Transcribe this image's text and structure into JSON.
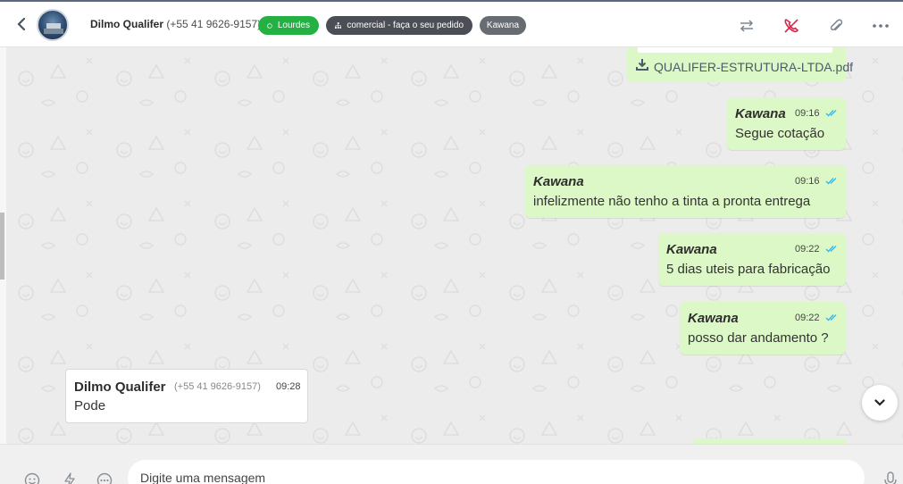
{
  "header": {
    "contact_name": "Dilmo Qualifer",
    "contact_phone": "(+55 41 9626-9157)",
    "tags": [
      {
        "label": "Lourdes",
        "color": "#25b043",
        "icon": "whatsapp-icon"
      },
      {
        "label": "comercial - faça o seu pedido",
        "color": "#4b4f55",
        "icon": "sitemap-icon"
      },
      {
        "label": "Kawana",
        "color": "#676b72"
      }
    ],
    "actions": [
      "transfer-icon",
      "end-call-icon",
      "attach-icon",
      "more-icon"
    ]
  },
  "messages": {
    "file": {
      "name": "QUALIFER-ESTRUTURA-LTDA.pdf"
    },
    "outgoing": [
      {
        "sender": "Kawana",
        "time": "09:16",
        "text": "Segue cotação"
      },
      {
        "sender": "Kawana",
        "time": "09:16",
        "text": "infelizmente não tenho a tinta a pronta entrega"
      },
      {
        "sender": "Kawana",
        "time": "09:22",
        "text": "5 dias uteis para fabricação"
      },
      {
        "sender": "Kawana",
        "time": "09:22",
        "text": "posso dar andamento ?"
      }
    ],
    "incoming": [
      {
        "sender": "Dilmo Qualifer",
        "phone": "(+55 41 9626-9157)",
        "time": "09:28",
        "text": "Pode"
      }
    ]
  },
  "composer": {
    "placeholder": "Digite uma mensagem"
  },
  "colors": {
    "outgoing_bubble": "#dcf8c6",
    "read_check": "#34b7f1",
    "end_call": "#d6284a"
  }
}
